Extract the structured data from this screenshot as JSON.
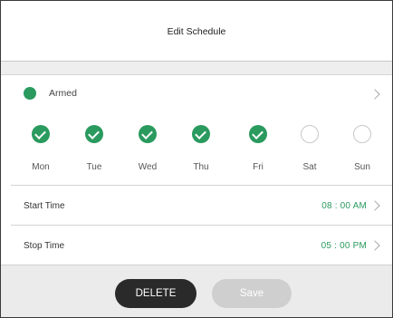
{
  "header": {
    "title": "Edit Schedule"
  },
  "mode": {
    "label": "Armed",
    "color": "#2a9a5f"
  },
  "days": [
    {
      "label": "Mon",
      "selected": true
    },
    {
      "label": "Tue",
      "selected": true
    },
    {
      "label": "Wed",
      "selected": true
    },
    {
      "label": "Thu",
      "selected": true
    },
    {
      "label": "Fri",
      "selected": true
    },
    {
      "label": "Sat",
      "selected": false
    },
    {
      "label": "Sun",
      "selected": false
    }
  ],
  "start_time": {
    "label": "Start Time",
    "value": "08 : 00 AM"
  },
  "stop_time": {
    "label": "Stop Time",
    "value": "05 : 00 PM"
  },
  "footer": {
    "delete_label": "DELETE",
    "save_label": "Save"
  },
  "colors": {
    "accent": "#2a9a5f",
    "delete_bg": "#2a2a2a",
    "save_bg": "#cfcfcf"
  }
}
